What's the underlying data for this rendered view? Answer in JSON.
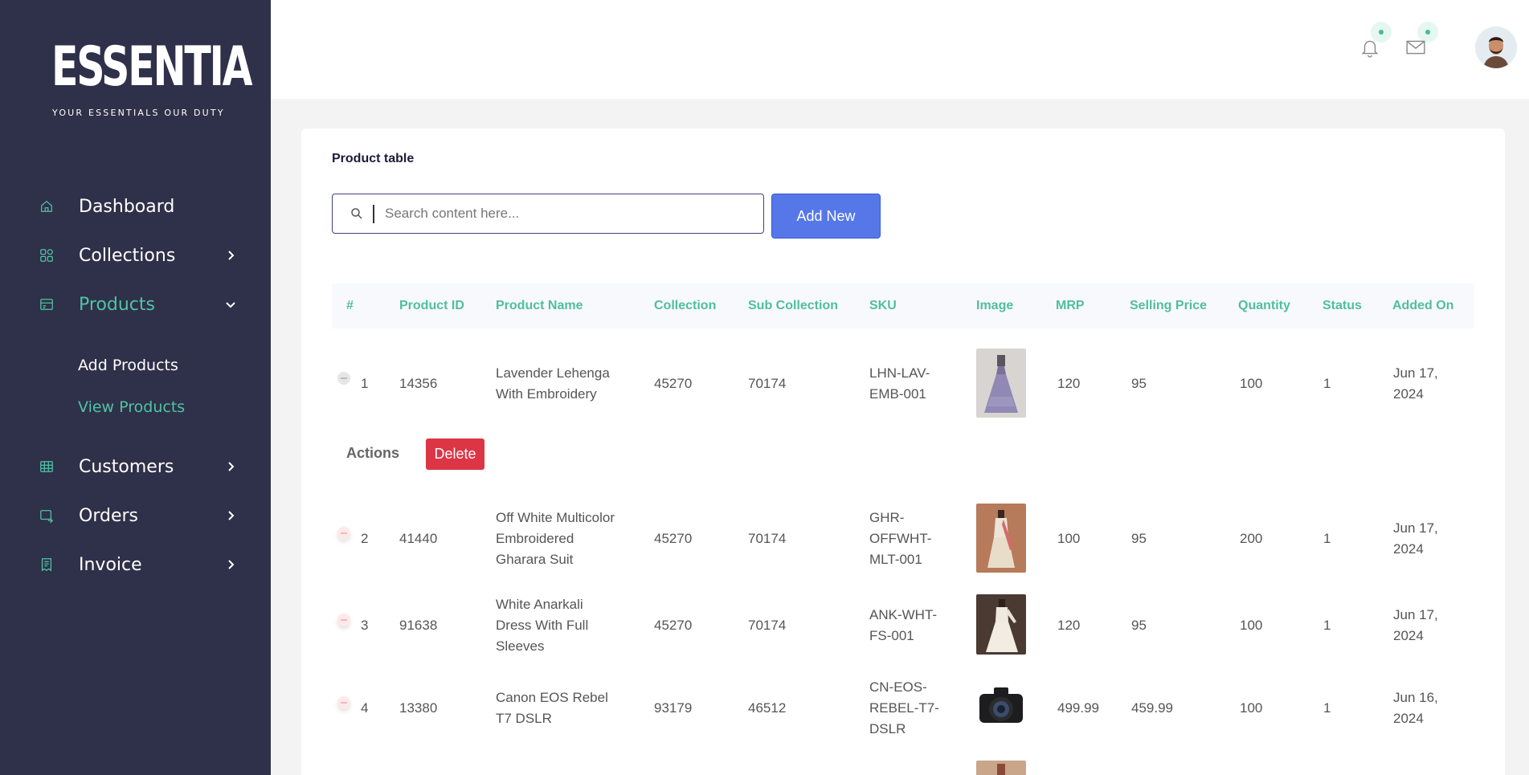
{
  "brand": {
    "logo_text": "ESSENTIA",
    "tagline": "YOUR ESSENTIALS OUR DUTY"
  },
  "sidebar": {
    "items": [
      {
        "label": "Dashboard",
        "icon": "home-icon"
      },
      {
        "label": "Collections",
        "icon": "grid-icon"
      },
      {
        "label": "Products",
        "icon": "box-icon"
      },
      {
        "label": "Customers",
        "icon": "table-icon"
      },
      {
        "label": "Orders",
        "icon": "cart-icon"
      },
      {
        "label": "Invoice",
        "icon": "receipt-icon"
      }
    ],
    "products_sub": [
      {
        "label": "Add Products"
      },
      {
        "label": "View Products"
      }
    ]
  },
  "main": {
    "card_title": "Product table",
    "search_placeholder": "Search content here...",
    "add_button": "Add New",
    "columns": [
      "#",
      "Product ID",
      "Product Name",
      "Collection",
      "Sub Collection",
      "SKU",
      "Image",
      "MRP",
      "Selling Price",
      "Quantity",
      "Status",
      "Added On"
    ],
    "actions_label": "Actions",
    "delete_button": "Delete",
    "rows": [
      {
        "n": "1",
        "id": "14356",
        "name": [
          "Lavender Lehenga",
          "With Embroidery"
        ],
        "collection": "45270",
        "sub": "70174",
        "sku": [
          "LHN-LAV-",
          "EMB-001"
        ],
        "mrp": "120",
        "price": "95",
        "qty": "100",
        "status": "1",
        "date": [
          "Jun 17,",
          "2024"
        ]
      },
      {
        "n": "2",
        "id": "41440",
        "name": [
          "Off White Multicolor",
          "Embroidered",
          "Gharara Suit"
        ],
        "collection": "45270",
        "sub": "70174",
        "sku": [
          "GHR-",
          "OFFWHT-",
          "MLT-001"
        ],
        "mrp": "100",
        "price": "95",
        "qty": "200",
        "status": "1",
        "date": [
          "Jun 17,",
          "2024"
        ]
      },
      {
        "n": "3",
        "id": "91638",
        "name": [
          "White Anarkali",
          "Dress With Full",
          "Sleeves"
        ],
        "collection": "45270",
        "sub": "70174",
        "sku": [
          "ANK-WHT-",
          "FS-001"
        ],
        "mrp": "120",
        "price": "95",
        "qty": "100",
        "status": "1",
        "date": [
          "Jun 17,",
          "2024"
        ]
      },
      {
        "n": "4",
        "id": "13380",
        "name": [
          "Canon EOS Rebel",
          "T7 DSLR"
        ],
        "collection": "93179",
        "sub": "46512",
        "sku": [
          "CN-EOS-",
          "REBEL-T7-",
          "DSLR"
        ],
        "mrp": "499.99",
        "price": "459.99",
        "qty": "100",
        "status": "1",
        "date": [
          "Jun 16,",
          "2024"
        ]
      }
    ]
  },
  "colors": {
    "sidebar_bg": "#2f3049",
    "accent_green": "#4fc4a4",
    "add_button": "#5677e8",
    "delete_button": "#dc3545"
  }
}
